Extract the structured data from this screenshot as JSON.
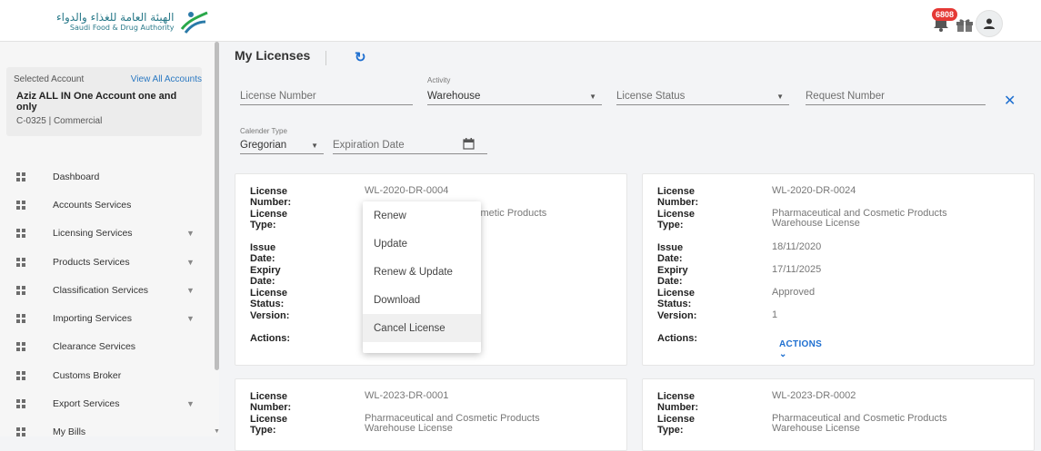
{
  "header": {
    "logo_arabic": "الهيئة العامة للغذاء والدواء",
    "logo_english": "Saudi Food & Drug Authority",
    "notification_count": "6808"
  },
  "sidebar": {
    "selected_account_label": "Selected Account",
    "view_all_label": "View All Accounts",
    "account_name": "Aziz ALL IN One Account one and only",
    "account_sub": "C-0325  |  Commercial",
    "items": [
      {
        "label": "Dashboard",
        "has_chevron": false
      },
      {
        "label": "Accounts Services",
        "has_chevron": false
      },
      {
        "label": "Licensing Services",
        "has_chevron": true
      },
      {
        "label": "Products Services",
        "has_chevron": true
      },
      {
        "label": "Classification Services",
        "has_chevron": true
      },
      {
        "label": "Importing Services",
        "has_chevron": true
      },
      {
        "label": "Clearance Services",
        "has_chevron": false
      },
      {
        "label": "Customs Broker",
        "has_chevron": false
      },
      {
        "label": "Export Services",
        "has_chevron": true
      },
      {
        "label": "My Bills",
        "has_chevron": false
      }
    ]
  },
  "main": {
    "title": "My Licenses",
    "filters": {
      "license_number_placeholder": "License Number",
      "activity_label": "Activity",
      "activity_value": "Warehouse",
      "license_status_placeholder": "License Status",
      "request_number_placeholder": "Request Number",
      "calendar_type_label": "Calender Type",
      "calendar_type_value": "Gregorian",
      "expiration_date_placeholder": "Expiration Date"
    },
    "field_labels": {
      "license_number": "License Number:",
      "license_type": "License Type:",
      "issue_date": "Issue Date:",
      "expiry_date": "Expiry Date:",
      "license_status": "License Status:",
      "version": "Version:",
      "actions": "Actions:"
    },
    "cards": [
      {
        "license_number": "WL-2020-DR-0004",
        "license_type": "Pharmaceutical and Cosmetic Products",
        "issue_date": "",
        "expiry_date": "",
        "license_status": "",
        "version": ""
      },
      {
        "license_number": "WL-2020-DR-0024",
        "license_type": "Pharmaceutical and Cosmetic Products Warehouse License",
        "issue_date": "18/11/2020",
        "expiry_date": "17/11/2025",
        "license_status": "Approved",
        "version": "1",
        "actions_label": "ACTIONS ⌄"
      },
      {
        "license_number": "WL-2023-DR-0001",
        "license_type": "Pharmaceutical and Cosmetic Products Warehouse License"
      },
      {
        "license_number": "WL-2023-DR-0002",
        "license_type": "Pharmaceutical and Cosmetic Products Warehouse License"
      }
    ],
    "actions_menu": [
      "Renew",
      "Update",
      "Renew & Update",
      "Download",
      "Cancel License"
    ],
    "first_card_type_visible_fragment": "smetic Products"
  }
}
